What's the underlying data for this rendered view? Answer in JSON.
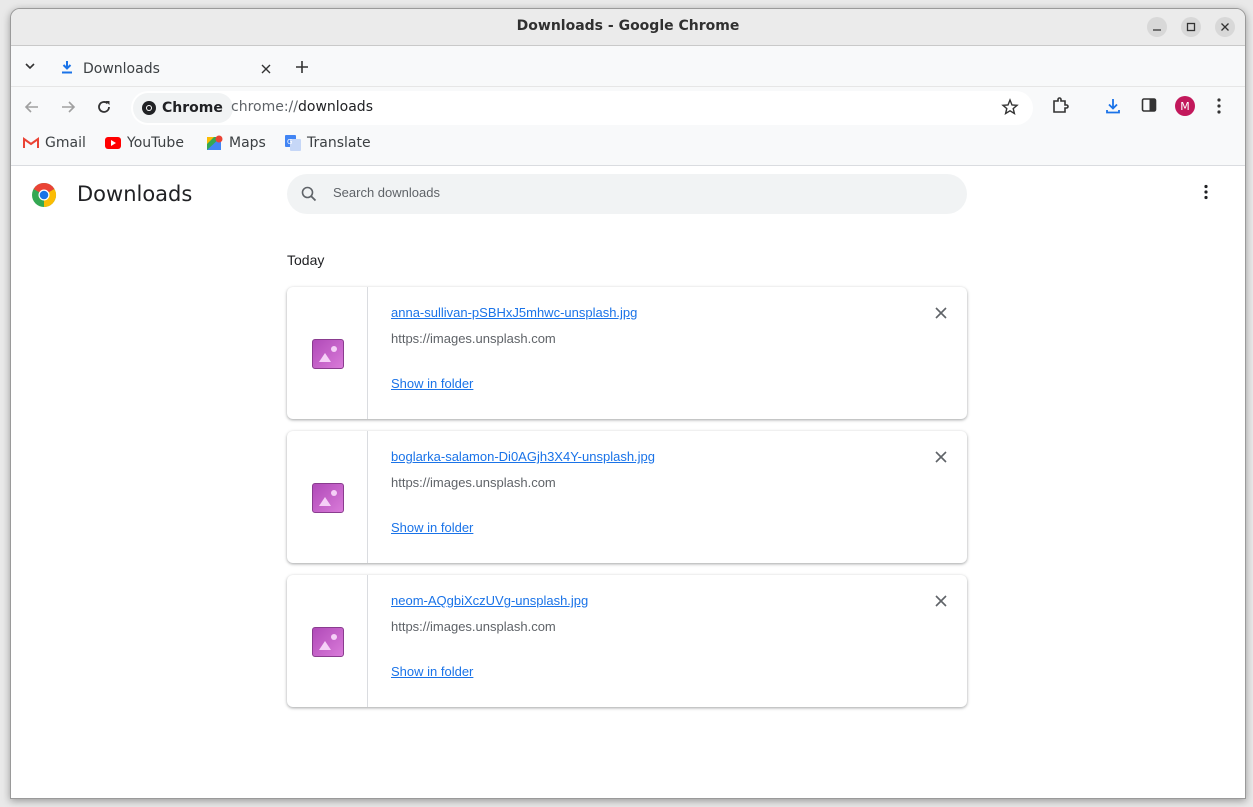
{
  "window": {
    "title": "Downloads - Google Chrome",
    "controls": [
      "minimize",
      "maximize",
      "close"
    ]
  },
  "tabs": [
    {
      "label": "Downloads",
      "icon": "download-icon",
      "active": true
    }
  ],
  "toolbar": {
    "site_chip": "Chrome",
    "url_scheme": "chrome://",
    "url_path": "downloads",
    "avatar_initial": "M",
    "avatar_color": "#c2185b",
    "download_icon_color": "#1a73e8"
  },
  "bookmarks": [
    {
      "label": "Gmail",
      "icon": "gmail-icon"
    },
    {
      "label": "YouTube",
      "icon": "youtube-icon"
    },
    {
      "label": "Maps",
      "icon": "maps-icon"
    },
    {
      "label": "Translate",
      "icon": "translate-icon"
    }
  ],
  "page": {
    "title": "Downloads",
    "search_placeholder": "Search downloads",
    "section": "Today",
    "downloads": [
      {
        "filename": "anna-sullivan-pSBHxJ5mhwc-unsplash.jpg",
        "source": "https://images.unsplash.com",
        "action": "Show in folder"
      },
      {
        "filename": "boglarka-salamon-Di0AGjh3X4Y-unsplash.jpg",
        "source": "https://images.unsplash.com",
        "action": "Show in folder"
      },
      {
        "filename": "neom-AQgbiXczUVg-unsplash.jpg",
        "source": "https://images.unsplash.com",
        "action": "Show in folder"
      }
    ]
  }
}
